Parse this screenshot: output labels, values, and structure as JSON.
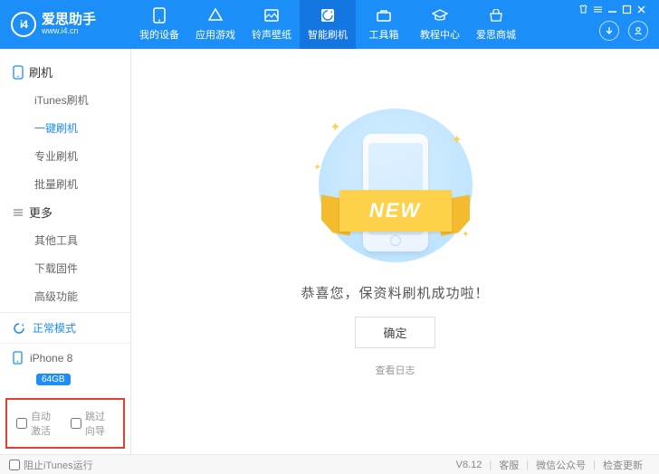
{
  "app": {
    "name": "爱思助手",
    "url": "www.i4.cn",
    "logo_text": "i4"
  },
  "nav": {
    "items": [
      {
        "label": "我的设备"
      },
      {
        "label": "应用游戏"
      },
      {
        "label": "铃声壁纸"
      },
      {
        "label": "智能刷机"
      },
      {
        "label": "工具箱"
      },
      {
        "label": "教程中心"
      },
      {
        "label": "爱思商城"
      }
    ],
    "active_index": 3
  },
  "sidebar": {
    "groups": [
      {
        "title": "刷机",
        "items": [
          "iTunes刷机",
          "一键刷机",
          "专业刷机",
          "批量刷机"
        ],
        "active_index": 1
      },
      {
        "title": "更多",
        "items": [
          "其他工具",
          "下载固件",
          "高级功能"
        ],
        "active_index": -1
      }
    ],
    "mode": "正常模式",
    "device": {
      "name": "iPhone 8",
      "capacity": "64GB"
    },
    "checks": {
      "auto_activate": "自动激活",
      "skip_guide": "跳过向导"
    }
  },
  "main": {
    "ribbon": "NEW",
    "message": "恭喜您，保资料刷机成功啦！",
    "ok": "确定",
    "log": "查看日志"
  },
  "footer": {
    "block_itunes": "阻止iTunes运行",
    "version": "V8.12",
    "support": "客服",
    "wechat": "微信公众号",
    "update": "检查更新"
  }
}
